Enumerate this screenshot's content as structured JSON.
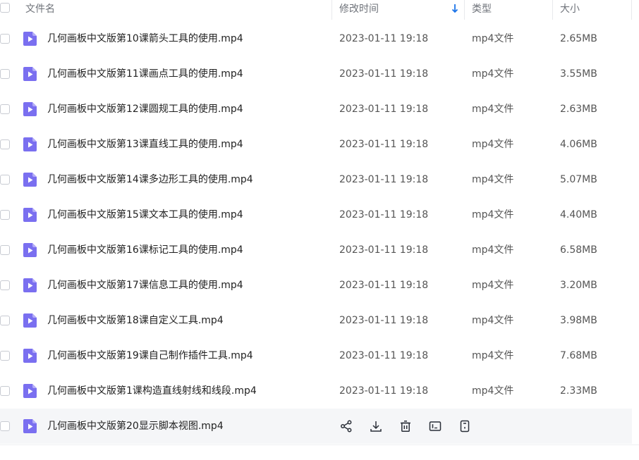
{
  "header": {
    "name": "文件名",
    "modified": "修改时间",
    "type": "类型",
    "size": "大小"
  },
  "colors": {
    "accent": "#1a73e8",
    "file_icon": "#7a6ff0",
    "hover_row": "#f5f6f8"
  },
  "rows": [
    {
      "name": "几何画板中文版第10课箭头工具的使用.mp4",
      "date": "2023-01-11 19:18",
      "type": "mp4文件",
      "size": "2.65MB"
    },
    {
      "name": "几何画板中文版第11课画点工具的使用.mp4",
      "date": "2023-01-11 19:18",
      "type": "mp4文件",
      "size": "3.55MB"
    },
    {
      "name": "几何画板中文版第12课圆规工具的使用.mp4",
      "date": "2023-01-11 19:18",
      "type": "mp4文件",
      "size": "2.63MB"
    },
    {
      "name": "几何画板中文版第13课直线工具的使用.mp4",
      "date": "2023-01-11 19:18",
      "type": "mp4文件",
      "size": "4.06MB"
    },
    {
      "name": "几何画板中文版第14课多边形工具的使用.mp4",
      "date": "2023-01-11 19:18",
      "type": "mp4文件",
      "size": "5.07MB"
    },
    {
      "name": "几何画板中文版第15课文本工具的使用.mp4",
      "date": "2023-01-11 19:18",
      "type": "mp4文件",
      "size": "4.40MB"
    },
    {
      "name": "几何画板中文版第16课标记工具的使用.mp4",
      "date": "2023-01-11 19:18",
      "type": "mp4文件",
      "size": "6.58MB"
    },
    {
      "name": "几何画板中文版第17课信息工具的使用.mp4",
      "date": "2023-01-11 19:18",
      "type": "mp4文件",
      "size": "3.20MB"
    },
    {
      "name": "几何画板中文版第18课自定义工具.mp4",
      "date": "2023-01-11 19:18",
      "type": "mp4文件",
      "size": "3.98MB"
    },
    {
      "name": "几何画板中文版第19课自己制作插件工具.mp4",
      "date": "2023-01-11 19:18",
      "type": "mp4文件",
      "size": "7.68MB"
    },
    {
      "name": "几何画板中文版第1课构造直线射线和线段.mp4",
      "date": "2023-01-11 19:18",
      "type": "mp4文件",
      "size": "2.33MB"
    }
  ],
  "hover_row": {
    "name": "几何画板中文版第20显示脚本视图.mp4",
    "actions": [
      "share-icon",
      "download-icon",
      "delete-icon",
      "rename-icon",
      "more-icon"
    ]
  }
}
